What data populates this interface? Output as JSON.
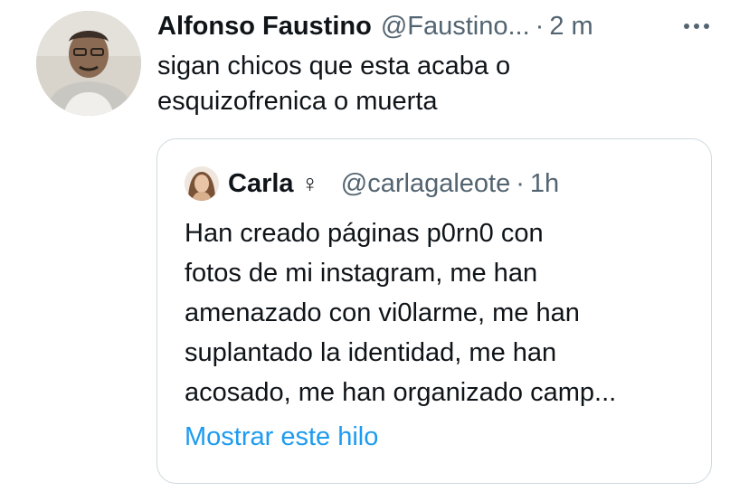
{
  "tweet": {
    "author_name": "Alfonso Faustino",
    "author_handle": "@Faustino...",
    "separator": "·",
    "time": "2 m",
    "text_lines": [
      "sigan chicos que esta acaba o",
      "esquizofrenica o muerta"
    ],
    "more_icon": "more-horizontal-icon"
  },
  "quoted_tweet": {
    "author_name": "Carla",
    "author_emoji": "♀",
    "author_handle": "@carlagaleote",
    "separator": "·",
    "time": "1h",
    "text_lines": [
      "Han creado páginas p0rn0 con",
      "fotos de mi instagram, me han",
      "amenazado con vi0larme, me han",
      "suplantado la identidad, me han",
      "acosado, me han organizado camp..."
    ],
    "show_thread_label": "Mostrar este hilo"
  },
  "colors": {
    "primary_text": "#0f1419",
    "secondary_text": "#536471",
    "link": "#1d9bf0",
    "border": "#cfd9de"
  }
}
